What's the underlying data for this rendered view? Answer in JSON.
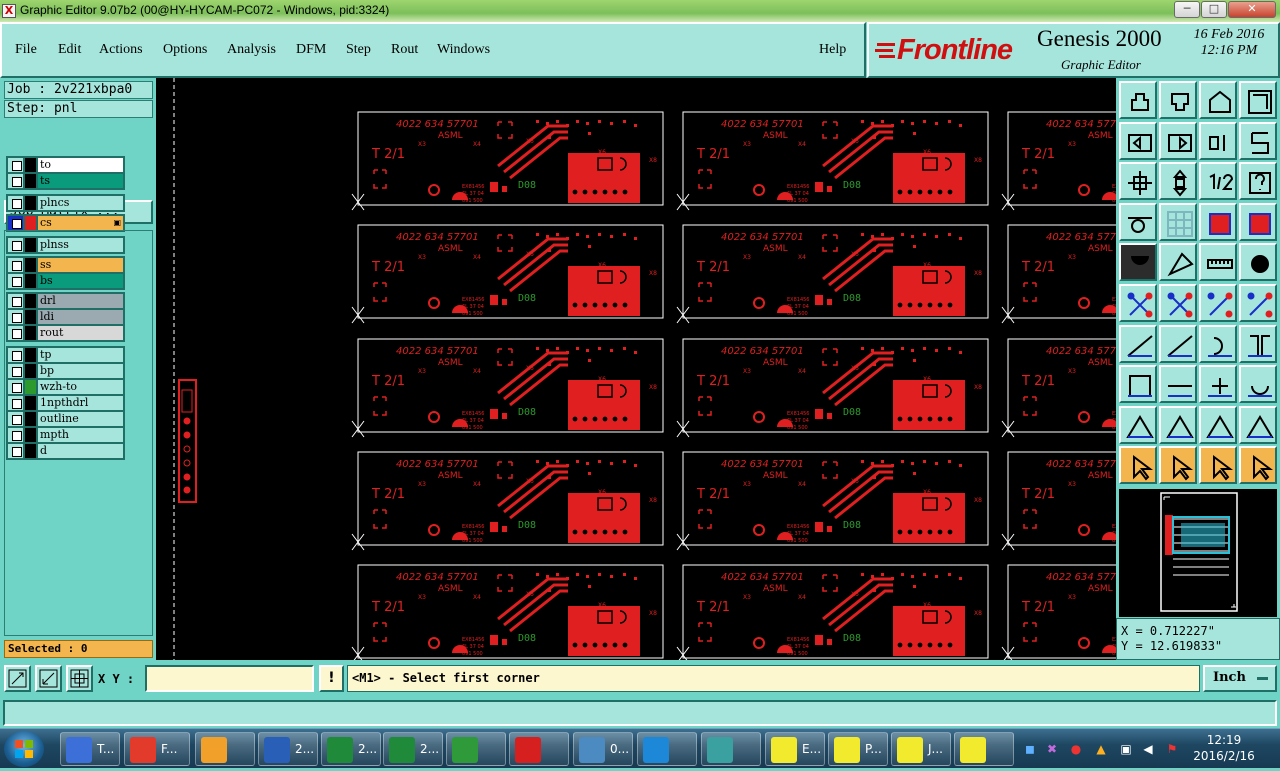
{
  "window": {
    "title": "Graphic Editor 9.07b2 (00@HY-HYCAM-PC072 - Windows, pid:3324)",
    "controls": [
      "─",
      "□",
      "✕"
    ]
  },
  "menu": [
    "File",
    "Edit",
    "Actions",
    "Options",
    "Analysis",
    "DFM",
    "Step",
    "Rout",
    "Windows",
    "Help"
  ],
  "brand": {
    "logo": "Frontline",
    "product": "Genesis 2000",
    "subtitle": "Graphic Editor",
    "date": "16 Feb 2016",
    "time": "12:16 PM"
  },
  "job": {
    "job_label": "Job : 2v221xbpa0",
    "step_label": "Step: pnl",
    "matrix_button": "Job Matrix ..."
  },
  "layers": [
    {
      "name": "to",
      "color": "#ffffff",
      "fill": "#ffffff"
    },
    {
      "name": "ts",
      "color": "#0a9a7c",
      "fill": "#0a9a7c"
    },
    {
      "name": "plncs",
      "color": "#a6e5db",
      "fill": "#a6e5db"
    },
    {
      "name": "cs",
      "color": "#e02020",
      "fill": "#f3b64f",
      "active": true
    },
    {
      "name": "plnss",
      "color": "#a6e5db",
      "fill": "#a6e5db"
    },
    {
      "name": "ss",
      "color": "#f3b64f",
      "fill": "#f3b64f"
    },
    {
      "name": "bs",
      "color": "#0a9a7c",
      "fill": "#0a9a7c"
    },
    {
      "name": "drl",
      "color": "#9aaab0",
      "fill": "#9aaab0"
    },
    {
      "name": "ldi",
      "color": "#9aaab0",
      "fill": "#9aaab0"
    },
    {
      "name": "rout",
      "color": "#d8d8d8",
      "fill": "#d8d8d8"
    },
    {
      "name": "tp",
      "color": "#a6e5db",
      "fill": "#a6e5db"
    },
    {
      "name": "bp",
      "color": "#a6e5db",
      "fill": "#a6e5db"
    },
    {
      "name": "wzh-to",
      "color": "#2c9a2c",
      "fill": "#a6e5db"
    },
    {
      "name": "1npthdrl",
      "color": "#a6e5db",
      "fill": "#a6e5db"
    },
    {
      "name": "outline",
      "color": "#a6e5db",
      "fill": "#a6e5db"
    },
    {
      "name": "mpth",
      "color": "#a6e5db",
      "fill": "#a6e5db"
    },
    {
      "name": "d",
      "color": "#a6e5db",
      "fill": "#a6e5db"
    }
  ],
  "selected": "Selected : 0",
  "board": {
    "part_number": "4022 634 57701",
    "vendor": "ASML",
    "label_tz": "T 2/1",
    "code": "D08",
    "refs": [
      "X3",
      "X4",
      "X5",
      "X6",
      "X8"
    ],
    "small_text": [
      "EX81456",
      "6L 37 04",
      "091 500"
    ]
  },
  "coordinates": {
    "x": "X = 0.712227\"",
    "y": "Y = 12.619833\""
  },
  "command": {
    "xy_label": "X Y :",
    "xy_value": "",
    "prompt": "<M1> - Select first corner",
    "unit": "Inch"
  },
  "taskbar": {
    "items": [
      {
        "label": "T...",
        "icon": "floppy-icon",
        "color": "#3c6fd8"
      },
      {
        "label": "F...",
        "icon": "fetion-icon",
        "color": "#e23b2b"
      },
      {
        "label": "",
        "icon": "shell-icon",
        "color": "#f1a12a"
      },
      {
        "label": "2...",
        "icon": "word-icon",
        "color": "#2a5fb8"
      },
      {
        "label": "2...",
        "icon": "excel-icon",
        "color": "#1f8a3a"
      },
      {
        "label": "2...",
        "icon": "excel-icon",
        "color": "#1f8a3a"
      },
      {
        "label": "",
        "icon": "p-icon",
        "color": "#2e9a3a"
      },
      {
        "label": "",
        "icon": "pdf-icon",
        "color": "#d62020"
      },
      {
        "label": "0...",
        "icon": "image-viewer-icon",
        "color": "#4c8ac2"
      },
      {
        "label": "",
        "icon": "f-icon",
        "color": "#1e88d8"
      },
      {
        "label": "",
        "icon": "eye-icon",
        "color": "#3aa0a0"
      },
      {
        "label": "E...",
        "icon": "genesis-icon",
        "color": "#f2ea2c"
      },
      {
        "label": "P...",
        "icon": "genesis-icon",
        "color": "#f2ea2c"
      },
      {
        "label": "J...",
        "icon": "genesis-icon",
        "color": "#f2ea2c"
      },
      {
        "label": "",
        "icon": "genesis-icon",
        "color": "#f2ea2c"
      }
    ],
    "clock_time": "12:19",
    "clock_date": "2016/2/16"
  }
}
